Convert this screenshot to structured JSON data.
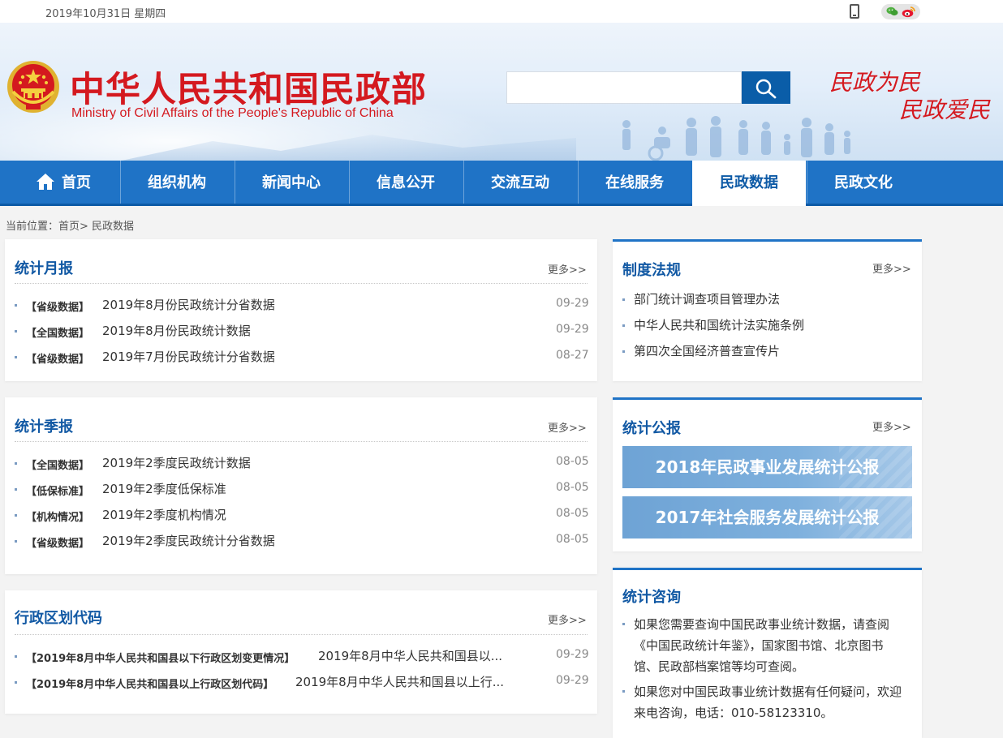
{
  "topbar": {
    "date": "2019年10月31日 星期四",
    "icons": [
      "mobile-icon",
      "wechat-icon",
      "weibo-icon"
    ]
  },
  "header": {
    "title": "中华人民共和国民政部",
    "subtitle": "Ministry of Civil Affairs of the People's Republic of China",
    "search_placeholder": "",
    "slogan_line1": "民政为民",
    "slogan_line2": "民政爱民",
    "brand_color": "#d4191f"
  },
  "nav": {
    "items": [
      {
        "label": "首页",
        "icon": "home-icon"
      },
      {
        "label": "组织机构"
      },
      {
        "label": "新闻中心"
      },
      {
        "label": "信息公开"
      },
      {
        "label": "交流互动"
      },
      {
        "label": "在线服务"
      },
      {
        "label": "民政数据",
        "active": true
      },
      {
        "label": "民政文化"
      }
    ],
    "color": "#1f73c6"
  },
  "breadcrumb": "当前位置：首页> 民政数据",
  "monthly": {
    "title": "统计月报",
    "more": "更多>>",
    "items": [
      {
        "tag": "【省级数据】",
        "title": "2019年8月份民政统计分省数据",
        "date": "09-29"
      },
      {
        "tag": "【全国数据】",
        "title": "2019年8月份民政统计数据",
        "date": "09-29"
      },
      {
        "tag": "【省级数据】",
        "title": "2019年7月份民政统计分省数据",
        "date": "08-27"
      }
    ]
  },
  "quarterly": {
    "title": "统计季报",
    "more": "更多>>",
    "items": [
      {
        "tag": "【全国数据】",
        "title": "2019年2季度民政统计数据",
        "date": "08-05"
      },
      {
        "tag": "【低保标准】",
        "title": "2019年2季度低保标准",
        "date": "08-05"
      },
      {
        "tag": "【机构情况】",
        "title": "2019年2季度机构情况",
        "date": "08-05"
      },
      {
        "tag": "【省级数据】",
        "title": "2019年2季度民政统计分省数据",
        "date": "08-05"
      }
    ]
  },
  "division": {
    "title": "行政区划代码",
    "more": "更多>>",
    "items": [
      {
        "tag": "【2019年8月中华人民共和国县以下行政区划变更情况】",
        "title": "2019年8月中华人民共和国县以...",
        "date": "09-29"
      },
      {
        "tag": "【2019年8月中华人民共和国县以上行政区划代码】",
        "title": "2019年8月中华人民共和国县以上行...",
        "date": "09-29"
      }
    ]
  },
  "regulations": {
    "title": "制度法规",
    "more": "更多>>",
    "items": [
      "部门统计调查项目管理办法",
      "中华人民共和国统计法实施条例",
      "第四次全国经济普查宣传片"
    ]
  },
  "bulletins": {
    "title": "统计公报",
    "more": "更多>>",
    "items": [
      "2018年民政事业发展统计公报",
      "2017年社会服务发展统计公报"
    ]
  },
  "consultation": {
    "title": "统计咨询",
    "paragraphs": [
      "如果您需要查询中国民政事业统计数据，请查阅《中国民政统计年鉴》，国家图书馆、北京图书馆、民政部档案馆等均可查阅。",
      "如果您对中国民政事业统计数据有任何疑问，欢迎来电咨询，电话：010-58123310。"
    ]
  }
}
